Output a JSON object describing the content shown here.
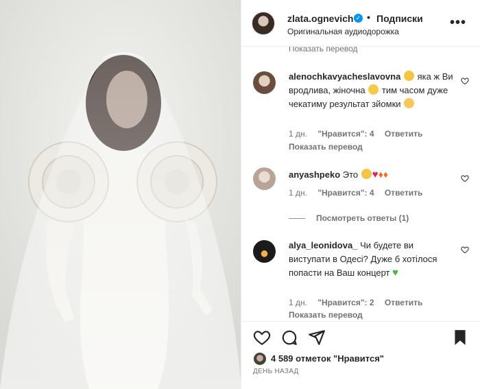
{
  "header": {
    "username": "zlata.ognevich",
    "verified_mark": "✓",
    "separator": "•",
    "follow_label": "Подписки",
    "audio_label": "Оригинальная аудиодорожка",
    "more_label": "•••"
  },
  "comments_partial_top": "Показать перевод",
  "comments": [
    {
      "username": "alenochkavyacheslavovna",
      "text_1": "яка ж Ви вродлива, жіночна",
      "text_2": "тим часом дуже чекатиму результат зйомки",
      "time": "1 дн.",
      "likes": "\"Нравится\": 4",
      "reply": "Ответить",
      "translate": "Показать перевод"
    },
    {
      "username": "anyashpeko",
      "text_1": "Это",
      "time": "1 дн.",
      "likes": "\"Нравится\": 4",
      "reply": "Ответить"
    },
    {
      "username": "alya_leonidova_",
      "text_1": "Чи будете ви виступати в Одесі? Дуже б хотілося попасти на Ваш концерт",
      "time": "1 дн.",
      "likes": "\"Нравится\": 2",
      "reply": "Ответить",
      "translate": "Показать перевод"
    }
  ],
  "view_replies": "Посмотреть ответы (1)",
  "footer": {
    "likes_text": "4 589 отметок \"Нравится\"",
    "date": "ДЕНЬ НАЗАД"
  },
  "icons": {
    "like": "heart-icon",
    "comment": "comment-icon",
    "share": "share-icon",
    "save": "bookmark-icon",
    "more": "more-icon"
  },
  "colors": {
    "text": "#262626",
    "muted": "#737373",
    "verified": "#0095f6",
    "border": "#efefef"
  }
}
